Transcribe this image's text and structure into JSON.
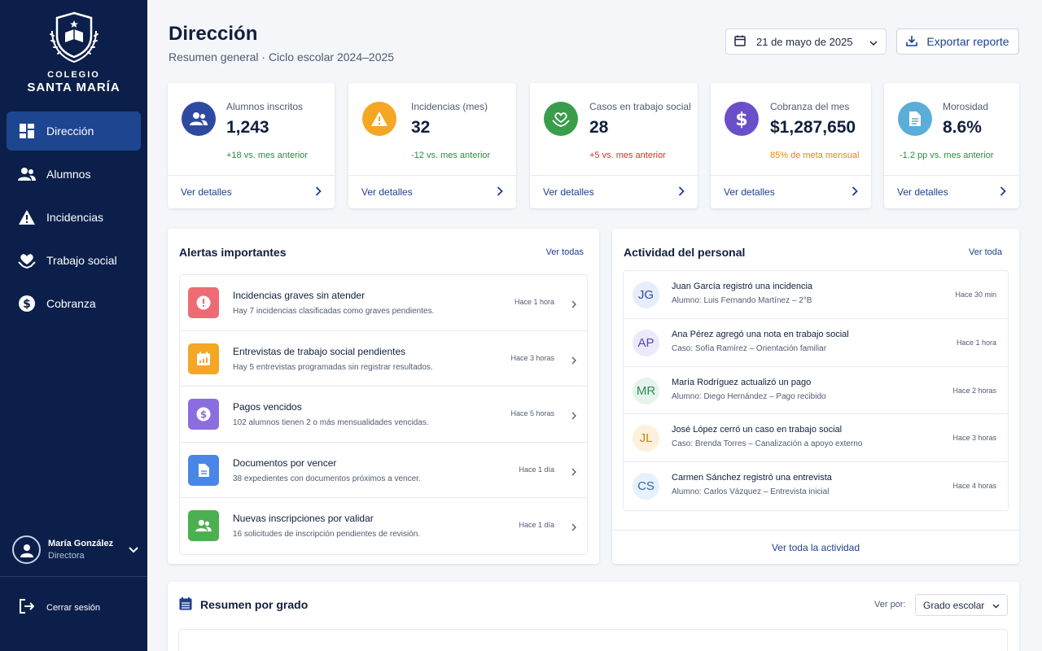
{
  "school": {
    "line1": "COLEGIO",
    "line2": "SANTA MARÍA"
  },
  "sidebar": {
    "items": [
      {
        "label": "Dirección",
        "icon": "dashboard-icon",
        "active": true
      },
      {
        "label": "Alumnos",
        "icon": "users-icon"
      },
      {
        "label": "Incidencias",
        "icon": "warning-icon"
      },
      {
        "label": "Trabajo social",
        "icon": "heart-hands-icon"
      },
      {
        "label": "Cobranza",
        "icon": "dollar-icon"
      }
    ],
    "user": {
      "name": "María González",
      "role": "Directora"
    },
    "logout": "Cerrar sesión"
  },
  "header": {
    "title": "Dirección",
    "subtitle": "Resumen general  ·  Ciclo escolar 2024–2025",
    "date": "21 de mayo de 2025",
    "export_label": "Exportar reporte"
  },
  "stats": [
    {
      "label": "Alumnos inscritos",
      "value": "1,243",
      "change": "+18 vs. mes anterior",
      "change_color": "#2e8b3e",
      "icon": "users-icon",
      "icon_bg": "#2d4aa0",
      "link": "Ver detalles"
    },
    {
      "label": "Incidencias (mes)",
      "value": "32",
      "change": "-12 vs. mes anterior",
      "change_color": "#2e8b3e",
      "icon": "warning-icon",
      "icon_bg": "#f5a623",
      "link": "Ver detalles"
    },
    {
      "label": "Casos en trabajo social",
      "value": "28",
      "change": "+5 vs. mes anterior",
      "change_color": "#d93025",
      "icon": "heart-hands-icon",
      "icon_bg": "#3a9d4a",
      "link": "Ver detalles"
    },
    {
      "label": "Cobranza del mes",
      "value": "$1,287,650",
      "change": "85% de meta mensual",
      "change_color": "#e08a00",
      "icon": "dollar-icon",
      "icon_bg": "#6b4fc9",
      "link": "Ver detalles"
    },
    {
      "label": "Morosidad",
      "value": "8.6%",
      "change": "-1.2 pp vs. mes anterior",
      "change_color": "#2e8b3e",
      "icon": "document-icon",
      "icon_bg": "#5aaed8",
      "link": "Ver detalles"
    }
  ],
  "alerts": {
    "title": "Alertas importantes",
    "link": "Ver todas",
    "items": [
      {
        "title": "Incidencias graves sin atender",
        "desc": "Hay 7 incidencias clasificadas como graves pendientes.",
        "time": "Hace 1 hora",
        "icon": "alert-circle-icon",
        "color": "#ef6b73"
      },
      {
        "title": "Entrevistas de trabajo social pendientes",
        "desc": "Hay 5 entrevistas programadas sin registrar resultados.",
        "time": "Hace 3 horas",
        "icon": "calendar-icon",
        "color": "#f5a623"
      },
      {
        "title": "Pagos vencidos",
        "desc": "102 alumnos tienen 2 o más mensualidades vencidas.",
        "time": "Hace 5 horas",
        "icon": "dollar-icon",
        "color": "#8a6ee0"
      },
      {
        "title": "Documentos por vencer",
        "desc": "38 expedientes con documentos próximos a vencer.",
        "time": "Hace 1 día",
        "icon": "document-icon",
        "color": "#4a86e8"
      },
      {
        "title": "Nuevas inscripciones por validar",
        "desc": "16 solicitudes de inscripción pendientes de revisión.",
        "time": "Hace 1 día",
        "icon": "users-icon",
        "color": "#4caf50"
      }
    ]
  },
  "activity": {
    "title": "Actividad del personal",
    "link": "Ver toda",
    "footer": "Ver toda la actividad",
    "items": [
      {
        "initials": "JG",
        "title": "Juan García registró una incidencia",
        "desc": "Alumno: Luis Fernando Martínez – 2°B",
        "time": "Hace 30 min",
        "bg": "#e7eefb",
        "fg": "#2d4aa0"
      },
      {
        "initials": "AP",
        "title": "Ana Pérez agregó una nota en trabajo social",
        "desc": "Caso: Sofía Ramírez – Orientación familiar",
        "time": "Hace 1 hora",
        "bg": "#ece9fb",
        "fg": "#5a44b8"
      },
      {
        "initials": "MR",
        "title": "María Rodríguez actualizó un pago",
        "desc": "Alumno: Diego Hernández – Pago recibido",
        "time": "Hace 2 horas",
        "bg": "#e4f4ec",
        "fg": "#2e8b57"
      },
      {
        "initials": "JL",
        "title": "José López cerró un caso en trabajo social",
        "desc": "Caso: Brenda Torres – Canalización a apoyo externo",
        "time": "Hace 3 horas",
        "bg": "#fdf1dc",
        "fg": "#c9860a"
      },
      {
        "initials": "CS",
        "title": "Carmen Sánchez registró una entrevista",
        "desc": "Alumno: Carlos Vázquez – Entrevista inicial",
        "time": "Hace 4 horas",
        "bg": "#e7f1fb",
        "fg": "#2d6aa8"
      }
    ]
  },
  "summary": {
    "title": "Resumen por grado",
    "view_label": "Ver por:",
    "view_value": "Grado escolar"
  }
}
